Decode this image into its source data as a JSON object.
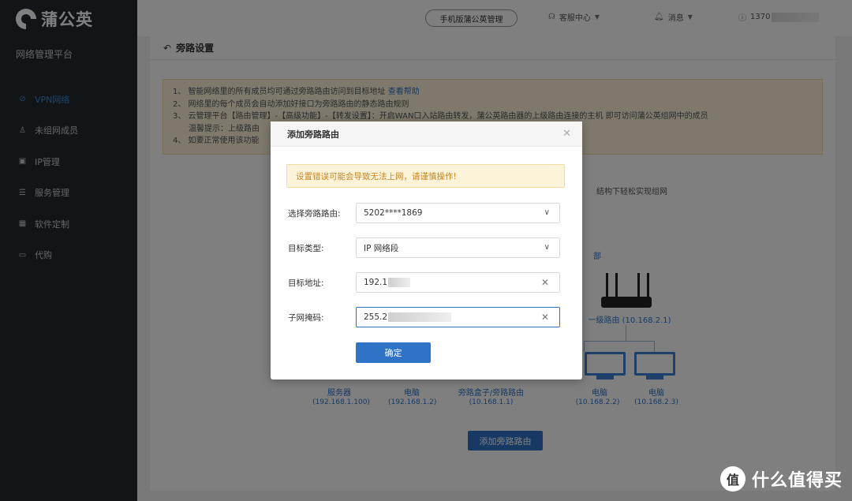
{
  "brand": {
    "name": "蒲公英",
    "platform": "网络管理平台"
  },
  "sidebar": {
    "items": [
      {
        "label": "VPN网络",
        "icon": "network-icon",
        "glyph": "⊘",
        "active": true
      },
      {
        "label": "未组网成员",
        "icon": "user-icon",
        "glyph": "♙"
      },
      {
        "label": "IP管理",
        "icon": "ip-icon",
        "glyph": "▣"
      },
      {
        "label": "服务管理",
        "icon": "service-icon",
        "glyph": "☰"
      },
      {
        "label": "软件定制",
        "icon": "apps-icon",
        "glyph": "▦"
      },
      {
        "label": "代购",
        "icon": "cart-icon",
        "glyph": "▭"
      }
    ]
  },
  "topbar": {
    "mobile_label": "手机版蒲公英管理",
    "support_label": "客服中心",
    "message_label": "消息",
    "user_label": "1370"
  },
  "page": {
    "title": "旁路设置",
    "notice_lines": [
      "1、 智能网络里的所有成员均可通过旁路路由访问到目标地址",
      "2、 网络里的每个成员会自动添加好接口为旁路路由的静态路由规则",
      "3、 云管理平台【路由管理】-【高级功能】-【转发设置】：开启WAN口入站路由转发，蒲公英路由器的上级路由连接的主机 即可访问蒲公英组网中的成员",
      "温馨提示：上级路由",
      "4、 如要正常使用该功能"
    ],
    "help_link": "查看帮助",
    "diagram_text": "结构下轻松实现组网",
    "label_bu": "部",
    "router_label": "一级路由 (10.168.2.1)",
    "devices": [
      {
        "name": "服务器",
        "ip": "(192.168.1.100)"
      },
      {
        "name": "电脑",
        "ip": "(192.168.1.2)"
      },
      {
        "name": "旁路盒子/旁路路由",
        "ip": "(10.168.1.1)"
      },
      {
        "name": "电脑",
        "ip": "(10.168.2.2)"
      },
      {
        "name": "电脑",
        "ip": "(10.168.2.3)"
      }
    ],
    "add_button": "添加旁路路由"
  },
  "modal": {
    "title": "添加旁路路由",
    "warning": "设置错误可能会导致无法上网，请谨慎操作!",
    "router_label": "选择旁路路由:",
    "router_value": "5202****1869",
    "type_label": "目标类型:",
    "type_value": "IP 网络段",
    "address_label": "目标地址:",
    "address_value": "192.1",
    "mask_label": "子网掩码:",
    "mask_value": "255.2",
    "ok_button": "确定"
  },
  "watermark": {
    "text": "什么值得买",
    "mark": "值"
  },
  "colors": {
    "sidebar": "#222a2f",
    "accent": "#2f73c6",
    "warning_bg": "#fdf3d9"
  }
}
